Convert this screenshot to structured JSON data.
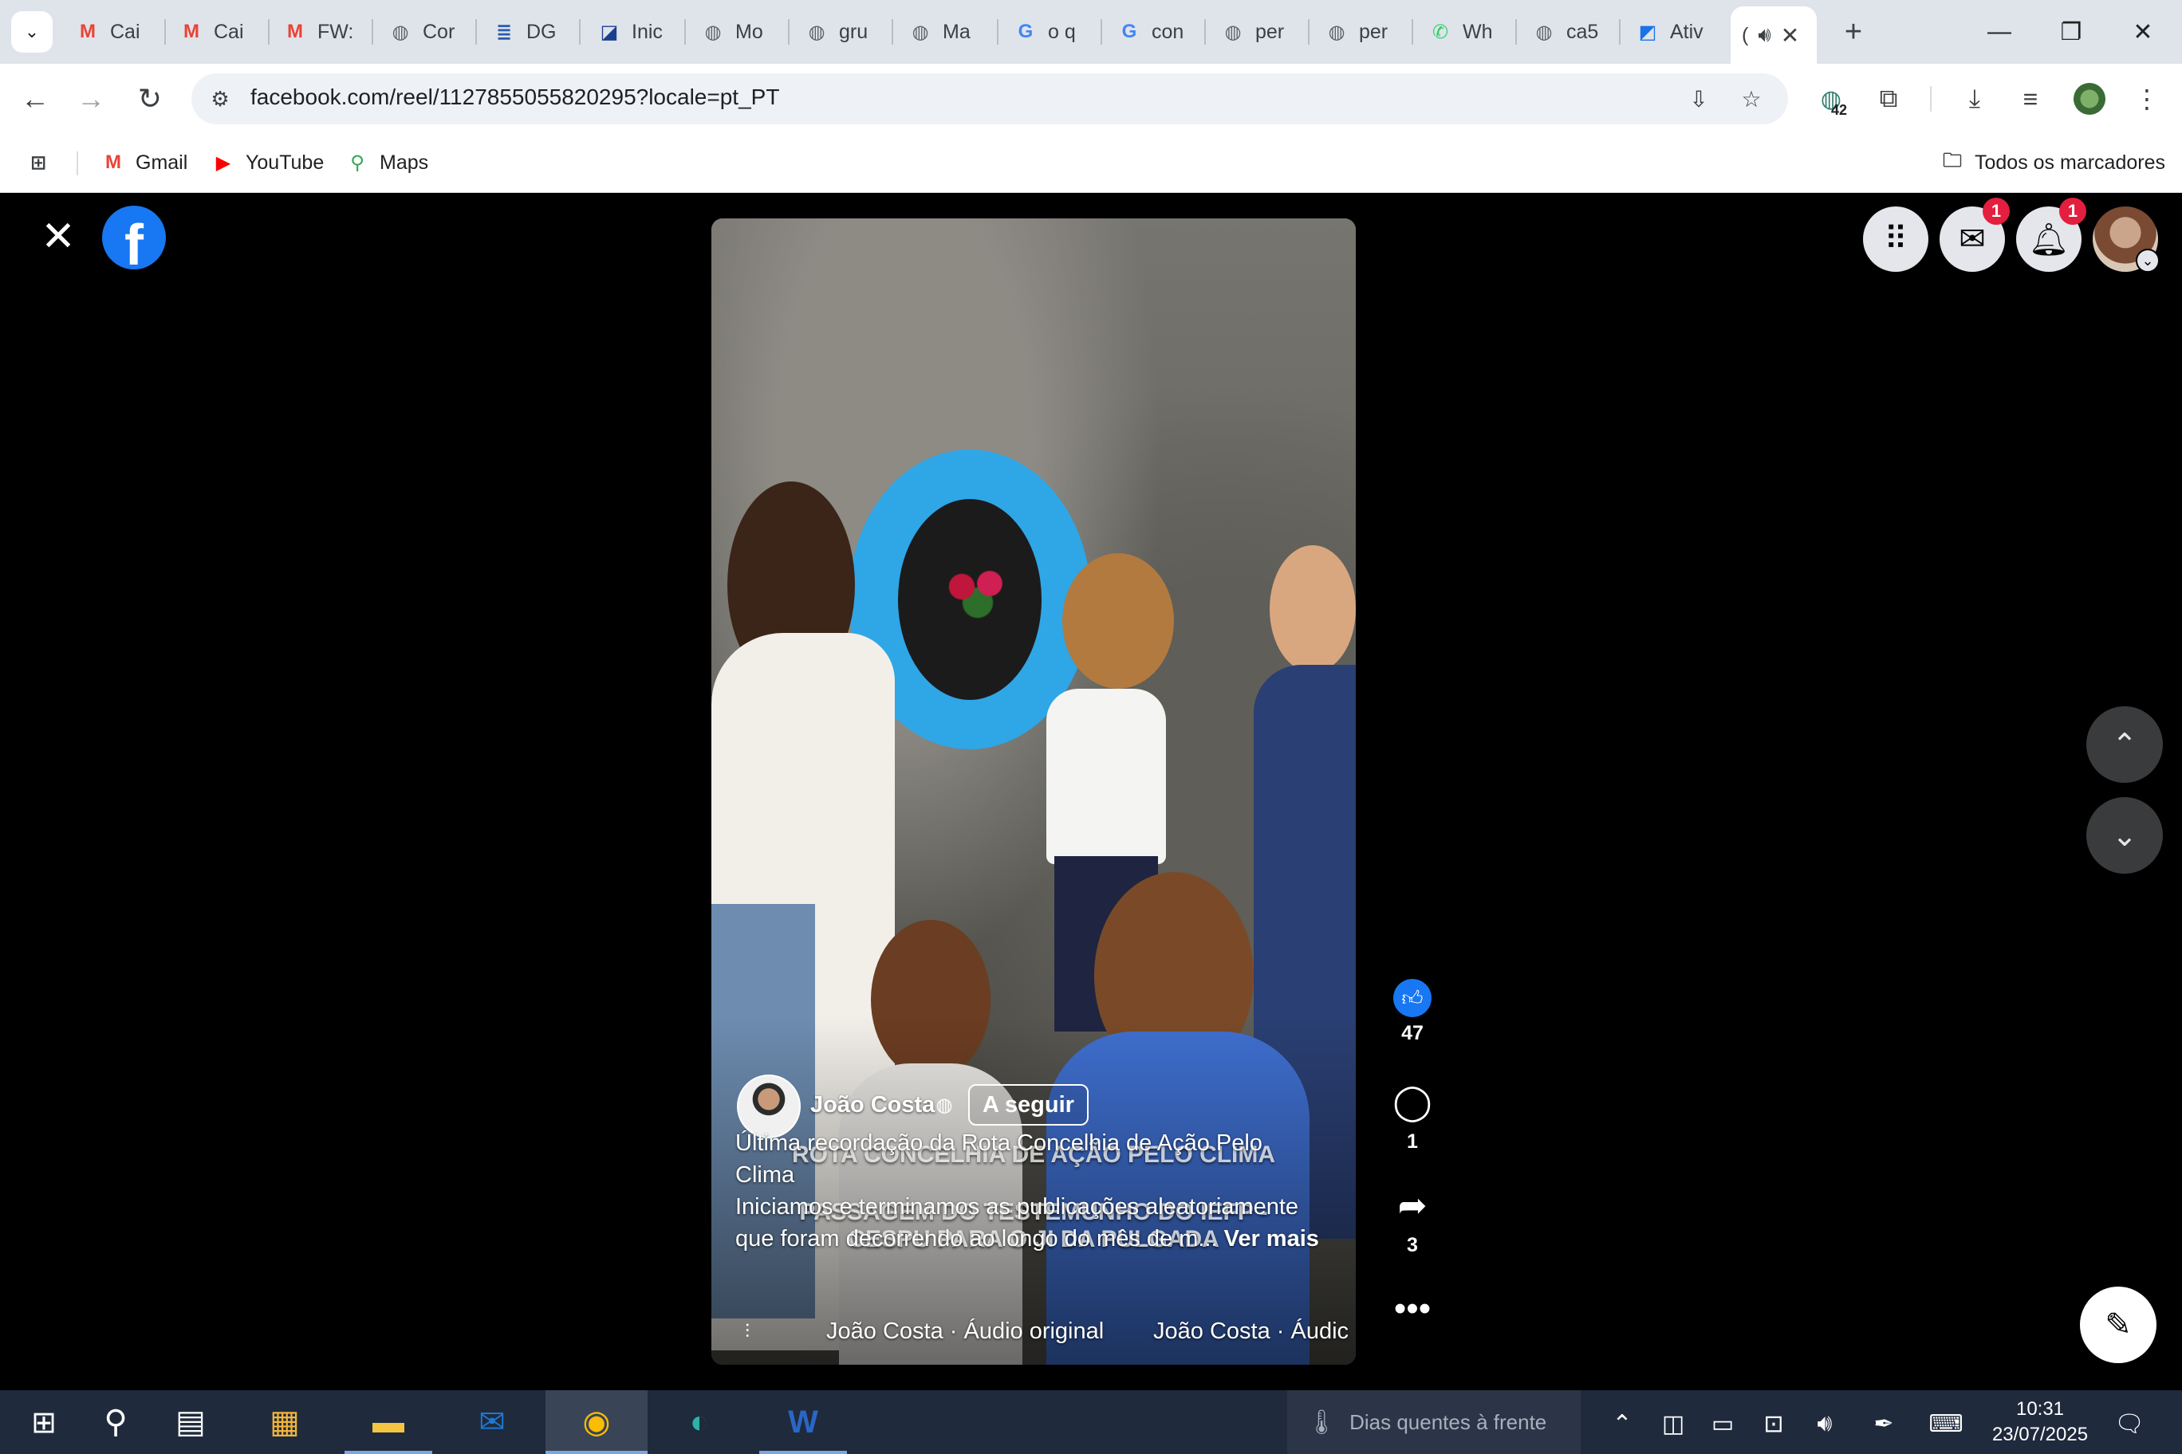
{
  "browser": {
    "tabs": [
      {
        "title": "Cai",
        "icon": "gmail-icon"
      },
      {
        "title": "Cai",
        "icon": "gmail-icon"
      },
      {
        "title": "FW:",
        "icon": "gmail-icon"
      },
      {
        "title": "Cor",
        "icon": "globe-icon"
      },
      {
        "title": "DG",
        "icon": "document-icon"
      },
      {
        "title": "Inic",
        "icon": "site-icon"
      },
      {
        "title": "Mo",
        "icon": "globe-icon"
      },
      {
        "title": "gru",
        "icon": "globe-icon"
      },
      {
        "title": "Ma",
        "icon": "globe-icon"
      },
      {
        "title": "o q",
        "icon": "google-icon"
      },
      {
        "title": "con",
        "icon": "google-icon"
      },
      {
        "title": "per",
        "icon": "globe-icon"
      },
      {
        "title": "per",
        "icon": "globe-icon"
      },
      {
        "title": "Wh",
        "icon": "whatsapp-icon"
      },
      {
        "title": "ca5",
        "icon": "globe-icon"
      },
      {
        "title": "Ativ",
        "icon": "site-icon"
      }
    ],
    "active_tab": {
      "title": "("
    },
    "url": "facebook.com/reel/1127855055820295?locale=pt_PT",
    "extension_badge": "42",
    "bookmarks": [
      {
        "label": "Gmail"
      },
      {
        "label": "YouTube"
      },
      {
        "label": "Maps"
      }
    ],
    "all_bookmarks_label": "Todos os marcadores"
  },
  "facebook": {
    "messenger_badge": "1",
    "notifications_badge": "1",
    "reel": {
      "overlay_line1": "ROTA CONCELHIA DE AÇÃO PELO CLIMA",
      "overlay_line2": "PASSAGEM DO TESTEMUNHO DO IEFP -",
      "overlay_line3": "CESPU PARA O JI DA PULGADA",
      "author": "João Costa",
      "follow_label": "A seguir",
      "caption": "Última recordação da Rota Concelhia de Ação Pelo Clima\nIniciamos e terminamos as publicações aleatoriamente que foram decorrendo ao longo do mês de m...",
      "see_more": "Ver mais",
      "audio_text_1": "João Costa · Áudio original",
      "audio_text_2": "João Costa · Áudic"
    },
    "actions": {
      "likes": "47",
      "comments": "1",
      "shares": "3"
    }
  },
  "taskbar": {
    "weather": "Dias quentes à frente",
    "time": "10:31",
    "date": "23/07/2025"
  }
}
